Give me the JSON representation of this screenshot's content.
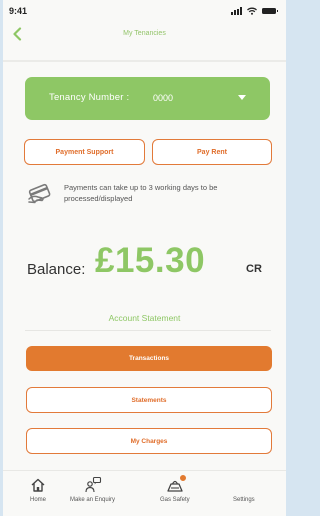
{
  "status_bar": {
    "time": "9:41"
  },
  "header": {
    "title": "My Tenancies"
  },
  "tenancy": {
    "label": "Tenancy Number :",
    "number": "0000"
  },
  "actions": {
    "payment_support": "Payment Support",
    "pay_rent": "Pay Rent"
  },
  "notice": {
    "text": "Payments can take up to 3 working days to be processed/displayed"
  },
  "balance": {
    "label": "Balance:",
    "amount": "£15.30",
    "suffix": "CR"
  },
  "statement": {
    "title": "Account Statement",
    "buttons": [
      "Transactions",
      "Statements",
      "My Charges"
    ]
  },
  "tabbar": {
    "items": [
      {
        "label": "Home",
        "icon": "home-icon"
      },
      {
        "label": "Make an Enquiry",
        "icon": "enquiry-icon"
      },
      {
        "label": "Gas Safety",
        "icon": "gas-safety-icon"
      },
      {
        "label": "Settings",
        "icon": "settings-icon"
      }
    ]
  },
  "colors": {
    "brand_green": "#8ec765",
    "brand_orange": "#e27a2f"
  }
}
